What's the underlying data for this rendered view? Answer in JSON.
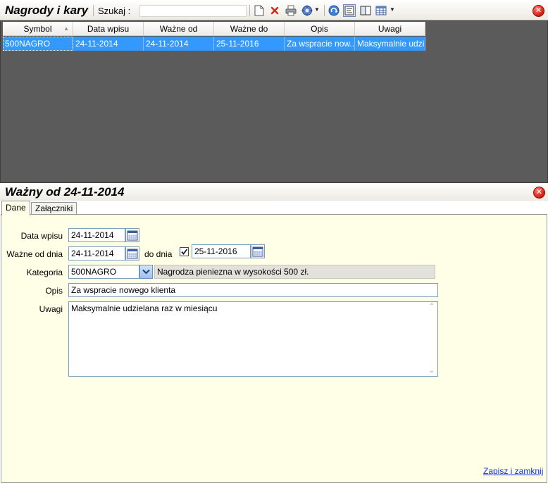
{
  "header": {
    "title": "Nagrody i kary",
    "search_label": "Szukaj :",
    "search_value": "",
    "icons": [
      "new-document-icon",
      "delete-icon",
      "print-icon",
      "settings-gear-icon",
      "refresh-icon",
      "filter-view-icon",
      "columns-icon",
      "table-view-icon",
      "close-icon"
    ]
  },
  "grid": {
    "columns": [
      "Symbol",
      "Data wpisu",
      "Ważne od",
      "Ważne do",
      "Opis",
      "Uwagi"
    ],
    "sorted_column": "Symbol",
    "rows": [
      [
        "500NAGRO",
        "24-11-2014",
        "24-11-2014",
        "25-11-2016",
        "Za wspracie now...",
        "Maksymalnie udzi..."
      ]
    ]
  },
  "detail": {
    "title": "Ważny od 24-11-2014",
    "tabs": [
      "Dane",
      "Załączniki"
    ],
    "active_tab": "Dane",
    "labels": {
      "data_wpisu": "Data wpisu",
      "wazne_od": "Ważne od dnia",
      "do_dnia": "do dnia",
      "kategoria": "Kategoria",
      "opis": "Opis",
      "uwagi": "Uwagi"
    },
    "values": {
      "data_wpisu": "24-11-2014",
      "wazne_od": "24-11-2014",
      "do_dnia": "25-11-2016",
      "do_dnia_checked": true,
      "kategoria_symbol": "500NAGRO",
      "kategoria_opis": "Nagrodza pieniezna w wysokości 500 zł.",
      "opis": "Za wspracie nowego klienta",
      "uwagi": "Maksymalnie udzielana raz w miesiącu"
    },
    "save_close": "Zapisz i zamknij"
  },
  "colors": {
    "selection": "#3399ff",
    "grid_background": "#5b5b5b",
    "form_background": "#ffffe8",
    "close_red": "#d41c10",
    "link": "#0b2ff0"
  }
}
